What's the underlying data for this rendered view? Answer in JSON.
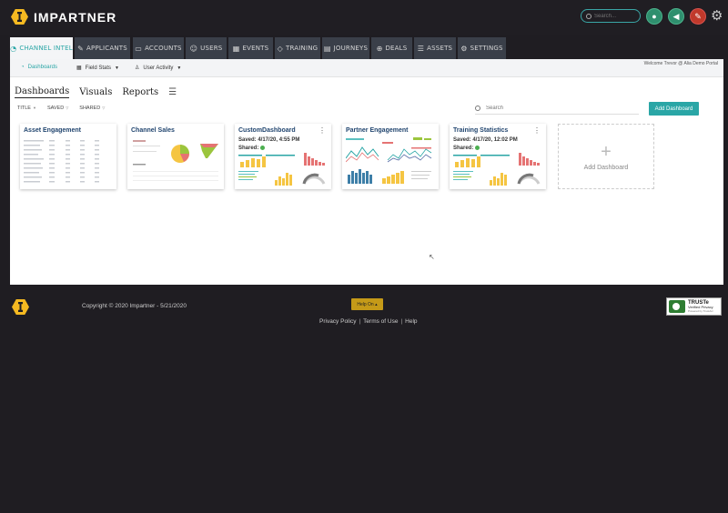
{
  "brand": {
    "name": "IMPARTNER"
  },
  "header": {
    "search_placeholder": "Search...",
    "icons": [
      "user-icon",
      "megaphone-icon",
      "pencil-icon",
      "gear-icon"
    ]
  },
  "nav": {
    "tabs": [
      {
        "label": "CHANNEL INTEL",
        "icon": "dashboard-icon",
        "active": true
      },
      {
        "label": "APPLICANTS",
        "icon": "pencil-icon"
      },
      {
        "label": "ACCOUNTS",
        "icon": "accounts-icon"
      },
      {
        "label": "USERS",
        "icon": "users-icon"
      },
      {
        "label": "EVENTS",
        "icon": "calendar-icon"
      },
      {
        "label": "TRAINING",
        "icon": "training-icon"
      },
      {
        "label": "JOURNEYS",
        "icon": "book-icon"
      },
      {
        "label": "DEALS",
        "icon": "deals-icon"
      },
      {
        "label": "ASSETS",
        "icon": "list-icon"
      },
      {
        "label": "SETTINGS",
        "icon": "gear-icon"
      }
    ]
  },
  "subnav": {
    "dashboards": "Dashboards",
    "field_stats": "Field Stats",
    "user_activity": "User Activity",
    "welcome": "Welcome Trevor @ Alia Demo Portal"
  },
  "views": {
    "tabs": [
      "Dashboards",
      "Visuals",
      "Reports"
    ],
    "active": "Dashboards"
  },
  "filters": {
    "title": "TITLE",
    "saved": "SAVED",
    "shared": "SHARED"
  },
  "search": {
    "placeholder": "Search"
  },
  "add_dashboard_button": "Add Dashboard",
  "cards": [
    {
      "title": "Asset Engagement"
    },
    {
      "title": "Channel Sales"
    },
    {
      "title": "CustomDashboard",
      "saved": "Saved: 4/17/20, 4:55 PM",
      "shared": "Shared:"
    },
    {
      "title": "Partner Engagement"
    },
    {
      "title": "Training Statistics",
      "saved": "Saved: 4/17/20, 12:02 PM",
      "shared": "Shared:"
    }
  ],
  "add_card_label": "Add Dashboard",
  "footer": {
    "copyright": "Copyright © 2020 Impartner - 5/21/2020",
    "help_button": "Help On ▴",
    "links": [
      "Privacy Policy",
      "Terms of Use",
      "Help"
    ],
    "truste": {
      "title": "TRUSTe",
      "subtitle": "Verified Privacy",
      "powered": "Powered by TrustArc"
    }
  },
  "colors": {
    "accent": "#2aa6a6",
    "brand_yellow": "#f5b921",
    "nav_bg": "#3a3f49",
    "card_title": "#21456f"
  }
}
